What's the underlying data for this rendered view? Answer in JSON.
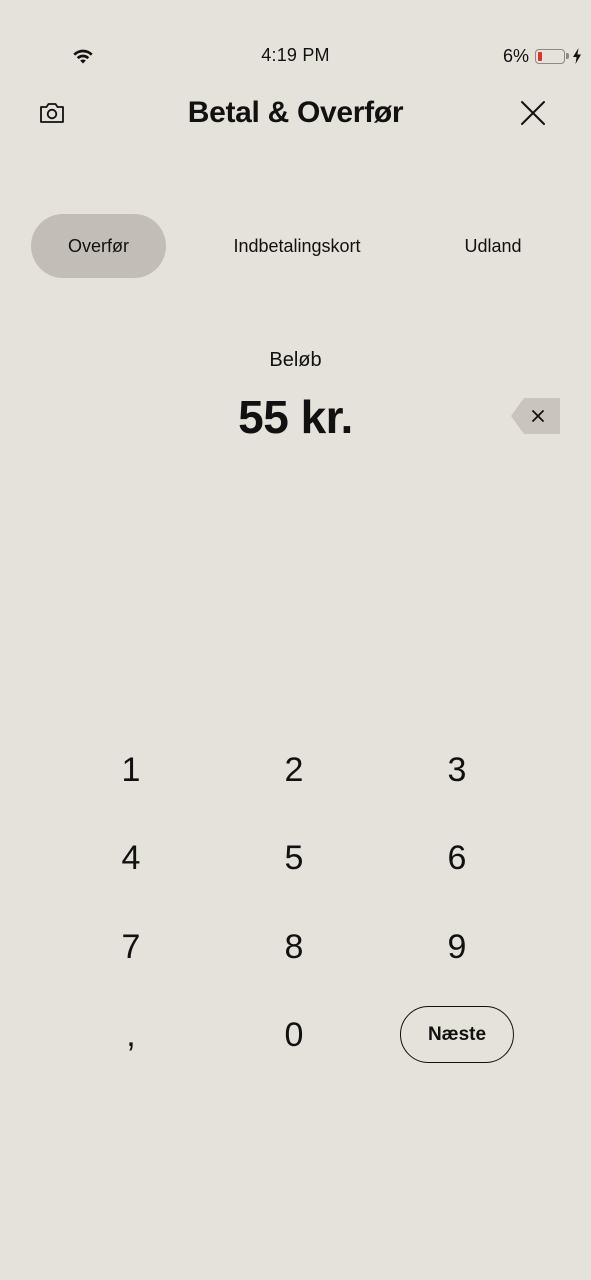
{
  "status_bar": {
    "time": "4:19 PM",
    "battery_percent": "6%",
    "battery_level": 0.06,
    "icons": [
      "wifi-icon",
      "battery-icon",
      "charging-bolt-icon"
    ]
  },
  "header": {
    "title": "Betal & Overfør",
    "left_icon": "camera-icon",
    "right_icon": "close-icon"
  },
  "tabs": [
    {
      "label": "Overfør",
      "active": true
    },
    {
      "label": "Indbetalingskort",
      "active": false
    },
    {
      "label": "Udland",
      "active": false
    }
  ],
  "amount": {
    "label": "Beløb",
    "value": "55 kr.",
    "clear_icon": "backspace-icon"
  },
  "keypad": {
    "keys": [
      "1",
      "2",
      "3",
      "4",
      "5",
      "6",
      "7",
      "8",
      "9",
      ",",
      "0"
    ],
    "next_label": "Næste"
  },
  "colors": {
    "background": "#e5e1db",
    "active_tab": "#c2bdb7",
    "backspace_bg": "#c9c4be",
    "battery_low": "#e0322c",
    "text": "#111111"
  }
}
